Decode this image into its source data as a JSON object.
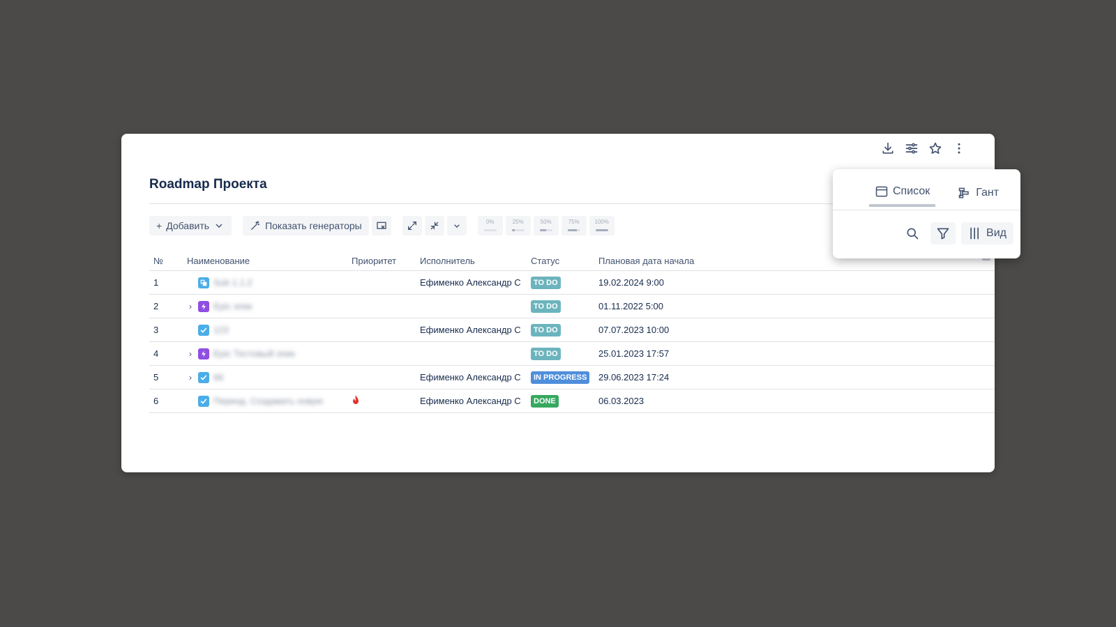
{
  "page": {
    "title": "Roadmap Проекта"
  },
  "toolbar": {
    "add_label": "Добавить",
    "generators_label": "Показать генераторы",
    "progress_buttons": [
      {
        "label": "0%",
        "value": 0
      },
      {
        "label": "25%",
        "value": 25
      },
      {
        "label": "50%",
        "value": 50
      },
      {
        "label": "75%",
        "value": 75
      },
      {
        "label": "100%",
        "value": 100
      }
    ]
  },
  "table": {
    "columns": [
      "№",
      "Наименование",
      "Приоритет",
      "Исполнитель",
      "Статус",
      "Плановая дата начала"
    ],
    "rows": [
      {
        "num": "1",
        "name": "Sub 1.1.2",
        "icon": "subtask-icon",
        "expandable": false,
        "priority": "",
        "assignee": "Ефименко Александр С",
        "status": "TO DO",
        "date": "19.02.2024 9:00"
      },
      {
        "num": "2",
        "name": "Epic эпик",
        "icon": "epic-icon",
        "expandable": true,
        "priority": "",
        "assignee": "",
        "status": "TO DO",
        "date": "01.11.2022 5:00"
      },
      {
        "num": "3",
        "name": "123",
        "icon": "task-icon",
        "expandable": false,
        "priority": "",
        "assignee": "Ефименко Александр С",
        "status": "TO DO",
        "date": "07.07.2023 10:00"
      },
      {
        "num": "4",
        "name": "Epic Тестовый эпик",
        "icon": "epic-icon",
        "expandable": true,
        "priority": "",
        "assignee": "",
        "status": "TO DO",
        "date": "25.01.2023 17:57"
      },
      {
        "num": "5",
        "name": "66",
        "icon": "task-icon",
        "expandable": true,
        "priority": "",
        "assignee": "Ефименко Александр С",
        "status": "IN PROGRESS",
        "date": "29.06.2023 17:24"
      },
      {
        "num": "6",
        "name": "Период. Создавать новую",
        "icon": "task-icon",
        "expandable": false,
        "priority": "highest",
        "assignee": "Ефименко Александр С",
        "status": "DONE",
        "date": "06.03.2023"
      }
    ]
  },
  "popover": {
    "tab_list": "Список",
    "tab_gantt": "Гант",
    "view_label": "Вид"
  },
  "colors": {
    "todo": "#6cb4bd",
    "in_progress": "#4f8edb",
    "done": "#36a860",
    "epic": "#904ee2",
    "task": "#4bade8",
    "priority_highest": "#e5322d"
  }
}
